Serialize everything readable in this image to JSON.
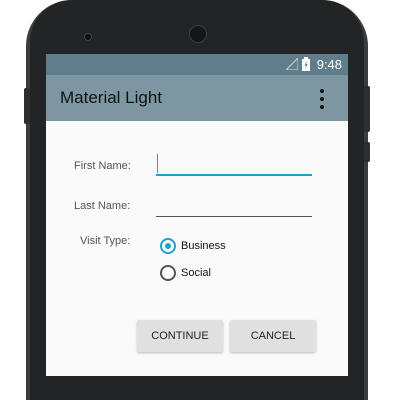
{
  "status_bar": {
    "time": "9:48",
    "signal_icon": "signal-icon",
    "battery_icon": "battery-charging-icon"
  },
  "app_bar": {
    "title": "Material Light",
    "menu_icon": "overflow-menu-icon"
  },
  "form": {
    "first_name": {
      "label": "First Name:",
      "value": ""
    },
    "last_name": {
      "label": "Last Name:",
      "value": ""
    },
    "visit_type": {
      "label": "Visit Type:",
      "options": [
        {
          "label": "Business",
          "checked": true
        },
        {
          "label": "Social",
          "checked": false
        }
      ]
    }
  },
  "buttons": {
    "continue_label": "CONTINUE",
    "cancel_label": "CANCEL"
  },
  "colors": {
    "status_bar": "#607d8b",
    "app_bar": "#7d97a2",
    "accent": "#20a2c8",
    "background": "#fafafa"
  }
}
